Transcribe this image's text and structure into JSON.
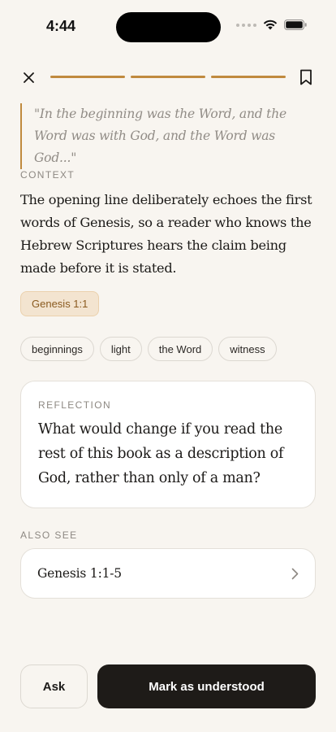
{
  "status": {
    "time": "4:44",
    "icons": [
      "signal-dots-icon",
      "wifi-icon",
      "battery-icon"
    ]
  },
  "header": {
    "close_icon": "close-icon",
    "bookmark_icon": "bookmark-icon",
    "progress_segments": 3,
    "accent_color": "#c08a3e"
  },
  "quote": {
    "text": "\"In the beginning was the Word, and the Word was with God, and the Word was God...\""
  },
  "context": {
    "label": "CONTEXT",
    "body": "The opening line deliberately echoes the first words of Genesis, so a reader who knows the Hebrew Scriptures hears the claim being made before it is stated.",
    "reference": "Genesis 1:1"
  },
  "tags": [
    "beginnings",
    "light",
    "the Word",
    "witness"
  ],
  "reflection": {
    "label": "REFLECTION",
    "prompt": "What would change if you read the rest of this book as a description of God, rather than only of a man?"
  },
  "also_see": {
    "label": "ALSO SEE",
    "items": [
      {
        "label": "Genesis 1:1-5"
      }
    ]
  },
  "actions": {
    "ask_label": "Ask",
    "primary_label": "Mark as understood"
  }
}
